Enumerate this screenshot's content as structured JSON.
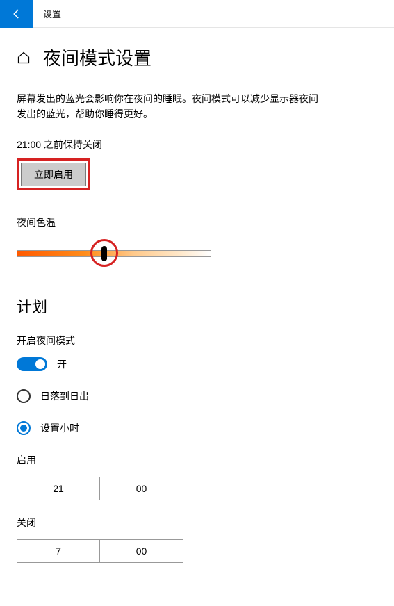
{
  "topbar": {
    "title": "设置"
  },
  "page": {
    "heading": "夜间模式设置",
    "description": "屏幕发出的蓝光会影响你在夜间的睡眠。夜间模式可以减少显示器夜间发出的蓝光，帮助你睡得更好。",
    "status": "21:00 之前保持关闭",
    "enable_now_button": "立即启用"
  },
  "color_temp": {
    "label": "夜间色温",
    "value_percent": 45
  },
  "schedule": {
    "heading": "计划",
    "enable_label": "开启夜间模式",
    "toggle_state": "开",
    "toggle_on": true,
    "options": {
      "sunset": "日落到日出",
      "set_hours": "设置小时",
      "selected": "set_hours"
    },
    "turn_on": {
      "label": "启用",
      "hour": "21",
      "minute": "00"
    },
    "turn_off": {
      "label": "关闭",
      "hour": "7",
      "minute": "00"
    }
  }
}
